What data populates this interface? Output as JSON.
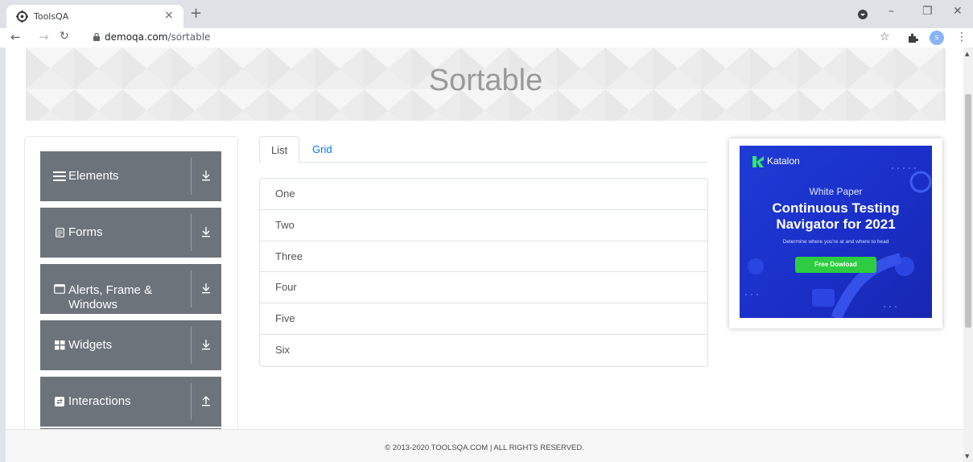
{
  "browser": {
    "tab_title": "ToolsQA",
    "tab_close": "×",
    "new_tab": "+",
    "url_host": "demoqa.com",
    "url_path": "/sortable",
    "profile_initial": "s",
    "window_controls": [
      "–",
      "❐",
      "✕"
    ]
  },
  "page": {
    "title": "Sortable"
  },
  "sidebar": {
    "groups": [
      {
        "label": "Elements",
        "icon": "hamburger-icon",
        "expanded": false
      },
      {
        "label": "Forms",
        "icon": "form-icon",
        "expanded": false
      },
      {
        "label": "Alerts, Frame & Windows",
        "icon": "window-icon",
        "expanded": false
      },
      {
        "label": "Widgets",
        "icon": "widgets-icon",
        "expanded": false
      },
      {
        "label": "Interactions",
        "icon": "interactions-icon",
        "expanded": true
      }
    ]
  },
  "tabs": [
    {
      "label": "List",
      "active": true
    },
    {
      "label": "Grid",
      "active": false
    }
  ],
  "list_items": [
    "One",
    "Two",
    "Three",
    "Four",
    "Five",
    "Six"
  ],
  "ad": {
    "brand": "Katalon",
    "subtitle": "White Paper",
    "headline_1": "Continuous Testing",
    "headline_2": "Navigator for 2021",
    "tagline": "Determine where you're at and where to head",
    "button": "Free Dowload"
  },
  "footer": {
    "text": "© 2013-2020 TOOLSQA.COM | ALL RIGHTS RESERVED."
  },
  "colors": {
    "menu_bg": "#6d737b",
    "link": "#007bff",
    "ad_bg": "#1f3bd6",
    "ad_button": "#2ecc40"
  }
}
